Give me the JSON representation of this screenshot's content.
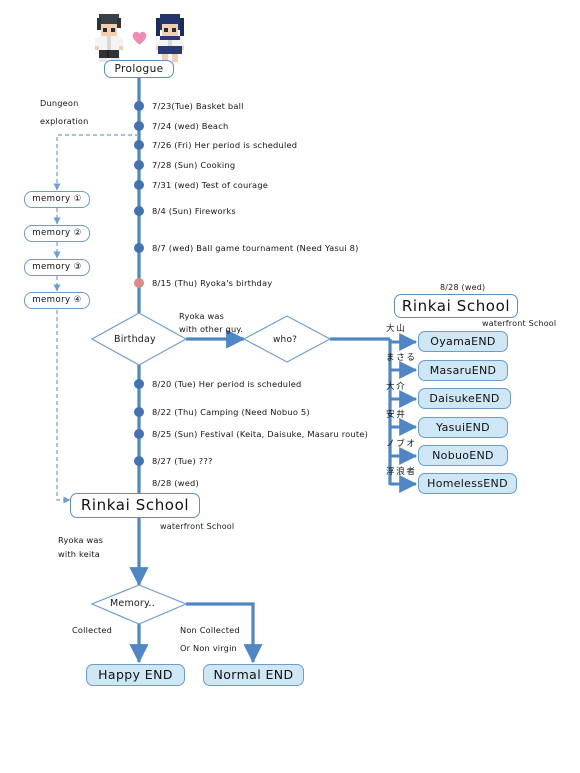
{
  "diagram": {
    "title": "Prologue route flowchart",
    "background": "#ffffff",
    "accent_line": "#4e86c6",
    "node_fill": "#cfe6f4",
    "node_border": "#5b8fc9",
    "dot_color": "#4173ae",
    "birthday_dot_color": "#dd8a8a",
    "dashed_color": "#6f9fd0",
    "heart_color": "#f08cb4"
  },
  "top": {
    "prologue_label": "Prologue",
    "left_char_name": "boy-sprite",
    "right_char_name": "girl-sprite",
    "heart_name": "heart-icon"
  },
  "dungeon": {
    "line1": "Dungeon",
    "line2": "exploration"
  },
  "memories": [
    {
      "label": "memory ①"
    },
    {
      "label": "memory ②"
    },
    {
      "label": "memory ③"
    },
    {
      "label": "memory ④"
    }
  ],
  "timeline": {
    "events_upper": [
      {
        "text": "7/23(Tue) Basket ball",
        "dot": "blue"
      },
      {
        "text": "7/24 (wed) Beach",
        "dot": "blue"
      },
      {
        "text": "7/26 (Fri) Her period is scheduled",
        "dot": "blue"
      },
      {
        "text": "7/28 (Sun) Cooking",
        "dot": "blue"
      },
      {
        "text": "7/31 (wed) Test of courage",
        "dot": "blue"
      },
      {
        "text": "8/4 (Sun) Fireworks",
        "dot": "blue"
      },
      {
        "text": "8/7 (wed) Ball game tournament (Need Yasui 8)",
        "dot": "blue"
      },
      {
        "text": "8/15 (Thu) Ryoka's birthday",
        "dot": "pink"
      }
    ],
    "events_lower": [
      {
        "text": "8/20 (Tue) Her period is scheduled",
        "dot": "blue"
      },
      {
        "text": "8/22 (Thu) Camping (Need Nobuo 5)",
        "dot": "blue"
      },
      {
        "text": "8/25 (Sun) Festival (Keita, Daisuke, Masaru route)",
        "dot": "blue"
      },
      {
        "text": "8/27 (Tue) ???",
        "dot": "blue"
      },
      {
        "text": "8/28 (wed)",
        "dot": "none"
      }
    ]
  },
  "decisions": {
    "birthday": "Birthday",
    "who": "who?",
    "memory": "Memory..",
    "birthday_branch_note_l1": "Ryoka was",
    "birthday_branch_note_l2": "with other guy.",
    "keita_note_l1": "Ryoka was",
    "keita_note_l2": "with keita"
  },
  "right_panel": {
    "date": "8/28 (wed)",
    "school_title": "Rinkai School",
    "school_subtitle": "waterfront School",
    "endings": [
      {
        "jp": "大山",
        "label": "OyamaEND"
      },
      {
        "jp": "まさる",
        "label": "MasaruEND"
      },
      {
        "jp": "大介",
        "label": "DaisukeEND"
      },
      {
        "jp": "安井",
        "label": "YasuiEND"
      },
      {
        "jp": "ノブオ",
        "label": "NobuoEND"
      },
      {
        "jp": "浮浪者",
        "label": "HomelessEND"
      }
    ]
  },
  "bottom": {
    "school_title": "Rinkai School",
    "school_subtitle": "waterfront School",
    "collected_label": "Collected",
    "non_collected_l1": "Non Collected",
    "non_collected_l2": "Or Non virgin",
    "happy_end": "Happy END",
    "normal_end": "Normal END"
  }
}
